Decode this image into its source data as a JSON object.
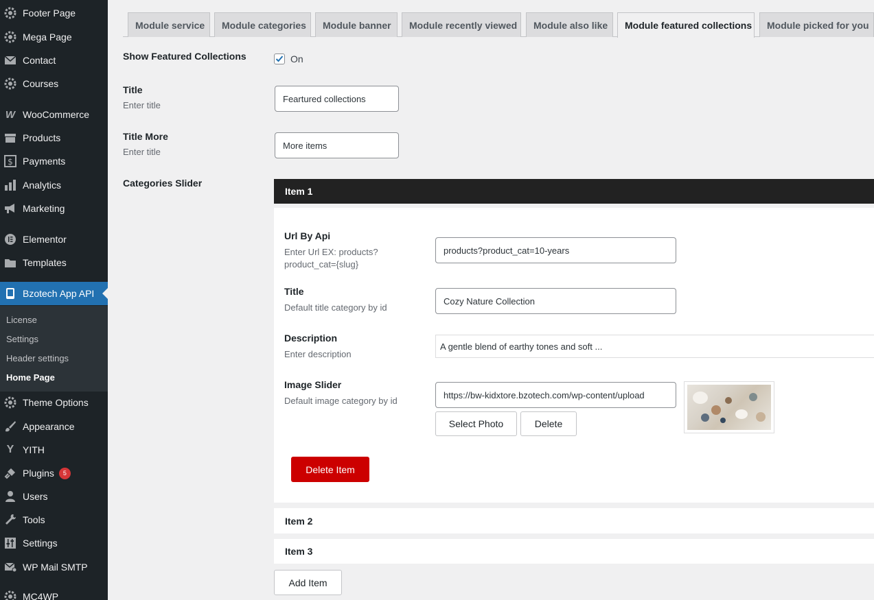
{
  "sidebar": {
    "items": [
      {
        "label": "Footer Page",
        "icon": "gear-circle-icon"
      },
      {
        "label": "Mega Page",
        "icon": "gear-circle-icon"
      },
      {
        "label": "Contact",
        "icon": "mail-icon"
      },
      {
        "label": "Courses",
        "icon": "gear-circle-icon"
      },
      {
        "label": "WooCommerce",
        "icon": "woo-icon"
      },
      {
        "label": "Products",
        "icon": "archive-icon"
      },
      {
        "label": "Payments",
        "icon": "dollar-icon"
      },
      {
        "label": "Analytics",
        "icon": "bar-chart-icon"
      },
      {
        "label": "Marketing",
        "icon": "megaphone-icon"
      },
      {
        "label": "Elementor",
        "icon": "elementor-icon"
      },
      {
        "label": "Templates",
        "icon": "folder-icon"
      },
      {
        "label": "Bzotech App API",
        "icon": "phone-icon"
      },
      {
        "label": "Theme Options",
        "icon": "gear-circle-icon"
      },
      {
        "label": "Appearance",
        "icon": "brush-icon"
      },
      {
        "label": "YITH",
        "icon": "yith-icon"
      },
      {
        "label": "Plugins",
        "icon": "plug-icon",
        "badge": "5"
      },
      {
        "label": "Users",
        "icon": "user-icon"
      },
      {
        "label": "Tools",
        "icon": "wrench-icon"
      },
      {
        "label": "Settings",
        "icon": "sliders-icon"
      },
      {
        "label": "WP Mail SMTP",
        "icon": "mail-smtp-icon"
      },
      {
        "label": "MC4WP",
        "icon": "gear-circle-icon"
      }
    ],
    "submenu": [
      "License",
      "Settings",
      "Header settings",
      "Home Page"
    ]
  },
  "tabs": [
    "Module service",
    "Module categories",
    "Module banner",
    "Module recently viewed",
    "Module also like",
    "Module featured collections",
    "Module picked for you"
  ],
  "form": {
    "show_label": "Show Featured Collections",
    "show_value": "On",
    "title_label": "Title",
    "title_desc": "Enter title",
    "title_value": "Feartured collections",
    "title_more_label": "Title More",
    "title_more_desc": "Enter title",
    "title_more_value": "More items",
    "slider_label": "Categories Slider"
  },
  "item1": {
    "header": "Item 1",
    "url_label": "Url By Api",
    "url_desc_1": "Enter Url EX: products?",
    "url_desc_2": "product_cat={slug}",
    "url_value": "products?product_cat=10-years",
    "title_label": "Title",
    "title_desc": "Default title category by id",
    "title_value": "Cozy Nature Collection",
    "desc_label": "Description",
    "desc_desc": "Enter description",
    "desc_value": "A gentle blend of earthy tones and soft ...",
    "image_label": "Image Slider",
    "image_desc": "Default image category by id",
    "image_value": "https://bw-kidxtore.bzotech.com/wp-content/upload",
    "select_photo": "Select Photo",
    "delete": "Delete",
    "delete_item": "Delete Item"
  },
  "item2": "Item 2",
  "item3": "Item 3",
  "add_item": "Add Item",
  "colors": {
    "sidebar": "#1d2327",
    "active": "#2271b1",
    "danger": "#cc0000",
    "badge": "#d63638"
  }
}
